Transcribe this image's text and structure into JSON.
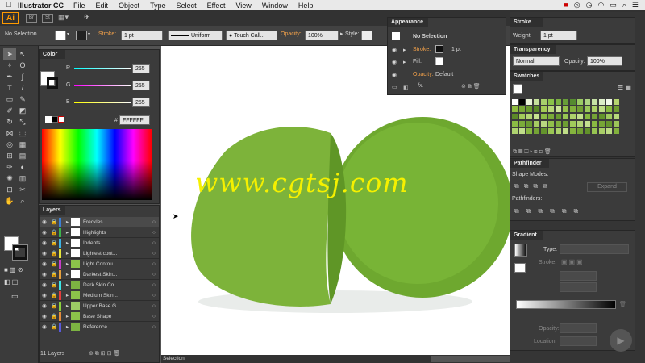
{
  "menubar": {
    "app_name": "Illustrator CC",
    "items": [
      "File",
      "Edit",
      "Object",
      "Type",
      "Select",
      "Effect",
      "View",
      "Window",
      "Help"
    ]
  },
  "appbar": {
    "logo": "Ai",
    "bridge": "Br",
    "stock": "St"
  },
  "control_bar": {
    "selection": "No Selection",
    "stroke_label": "Stroke:",
    "stroke_value": "1 pt",
    "profile": "Uniform",
    "brush": "Touch Call...",
    "opacity_label": "Opacity:",
    "opacity_value": "100%",
    "style_label": "Style:"
  },
  "color_panel": {
    "title": "Color",
    "r_label": "R",
    "r": "255",
    "g_label": "G",
    "g": "255",
    "b_label": "B",
    "b": "255",
    "hex_prefix": "#",
    "hex": "FFFFFF"
  },
  "layers_panel": {
    "title": "Layers",
    "count_label": "11 Layers",
    "layers": [
      {
        "name": "Freckles",
        "color": "#3c7fd6"
      },
      {
        "name": "Highlights",
        "color": "#3cb44b"
      },
      {
        "name": "Indents",
        "color": "#3cb4e6"
      },
      {
        "name": "Lightest cont...",
        "color": "#e6e63c"
      },
      {
        "name": "Light Contou...",
        "color": "#c83cc8"
      },
      {
        "name": "Darkest Skin...",
        "color": "#e6a03c"
      },
      {
        "name": "Dark Skin Co...",
        "color": "#3ce6e6"
      },
      {
        "name": "Medium Skin...",
        "color": "#e63c3c"
      },
      {
        "name": "Upper Base G...",
        "color": "#8cd23c"
      },
      {
        "name": "Base Shape",
        "color": "#e68c3c"
      },
      {
        "name": "Reference",
        "color": "#5a5adc"
      }
    ]
  },
  "appearance_panel": {
    "title": "Appearance",
    "selection": "No Selection",
    "stroke_label": "Stroke:",
    "stroke_value": "1 pt",
    "fill_label": "Fill:",
    "opacity_label": "Opacity:",
    "opacity_value": "Default",
    "fx": "fx."
  },
  "stroke_panel": {
    "title": "Stroke",
    "weight_label": "Weight:",
    "weight_value": "1 pt"
  },
  "transparency_panel": {
    "title": "Transparency",
    "mode": "Normal",
    "opacity_label": "Opacity:",
    "opacity_value": "100%"
  },
  "swatches_panel": {
    "title": "Swatches"
  },
  "pathfinder_panel": {
    "title": "Pathfinder",
    "shape_modes": "Shape Modes:",
    "expand": "Expand",
    "pathfinders": "Pathfinders:"
  },
  "gradient_panel": {
    "title": "Gradient",
    "type_label": "Type:",
    "stroke_label": "Stroke:",
    "opacity_label": "Opacity:",
    "location_label": "Location:"
  },
  "canvas": {
    "watermark": "www.cgtsj.com"
  },
  "statusbar": {
    "tool": "Selection"
  }
}
